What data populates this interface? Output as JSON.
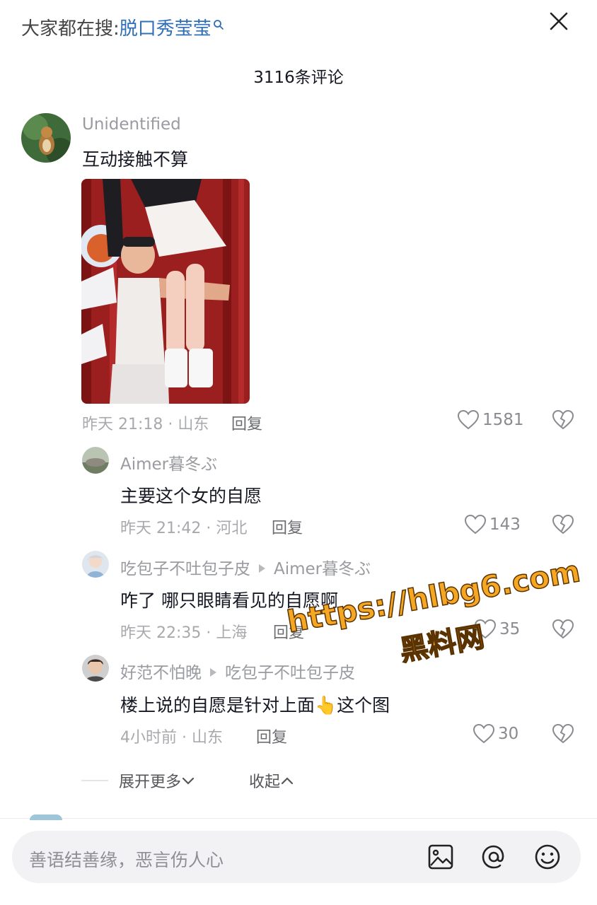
{
  "header": {
    "hot_search_prefix": "大家都在搜:",
    "hot_search_keyword": "脱口秀莹莹",
    "comment_count": "3116条评论"
  },
  "comments": [
    {
      "user": "Unidentified",
      "text": "互动接触不算",
      "time": "昨天 21:18 · 山东",
      "reply_label": "回复",
      "likes": "1581"
    },
    {
      "user": "Aimer暮冬ぶ",
      "text": "主要这个女的自愿",
      "time": "昨天 21:42 · 河北",
      "reply_label": "回复",
      "likes": "143"
    },
    {
      "user": "吃包子不吐包子皮",
      "reply_to": "Aimer暮冬ぶ",
      "text": "咋了 哪只眼睛看见的自愿啊",
      "time": "昨天 22:35 · 上海",
      "reply_label": "回复",
      "likes": "35"
    },
    {
      "user": "好范不怕晚",
      "reply_to": "吃包子不吐包子皮",
      "text": "楼上说的自愿是针对上面👆这个图",
      "time": "4小时前 · 山东",
      "reply_label": "回复",
      "likes": "30"
    }
  ],
  "thread": {
    "expand_label": "展开更多",
    "collapse_label": "收起"
  },
  "watermark": {
    "url": "https://hlbg6.com",
    "name": "黑料网"
  },
  "input": {
    "placeholder": "善语结善缘，恶言伤人心"
  },
  "colors": {
    "keyword": "#2f6fb8",
    "meta": "#a8a9ad",
    "watermark": "#f5a623"
  }
}
